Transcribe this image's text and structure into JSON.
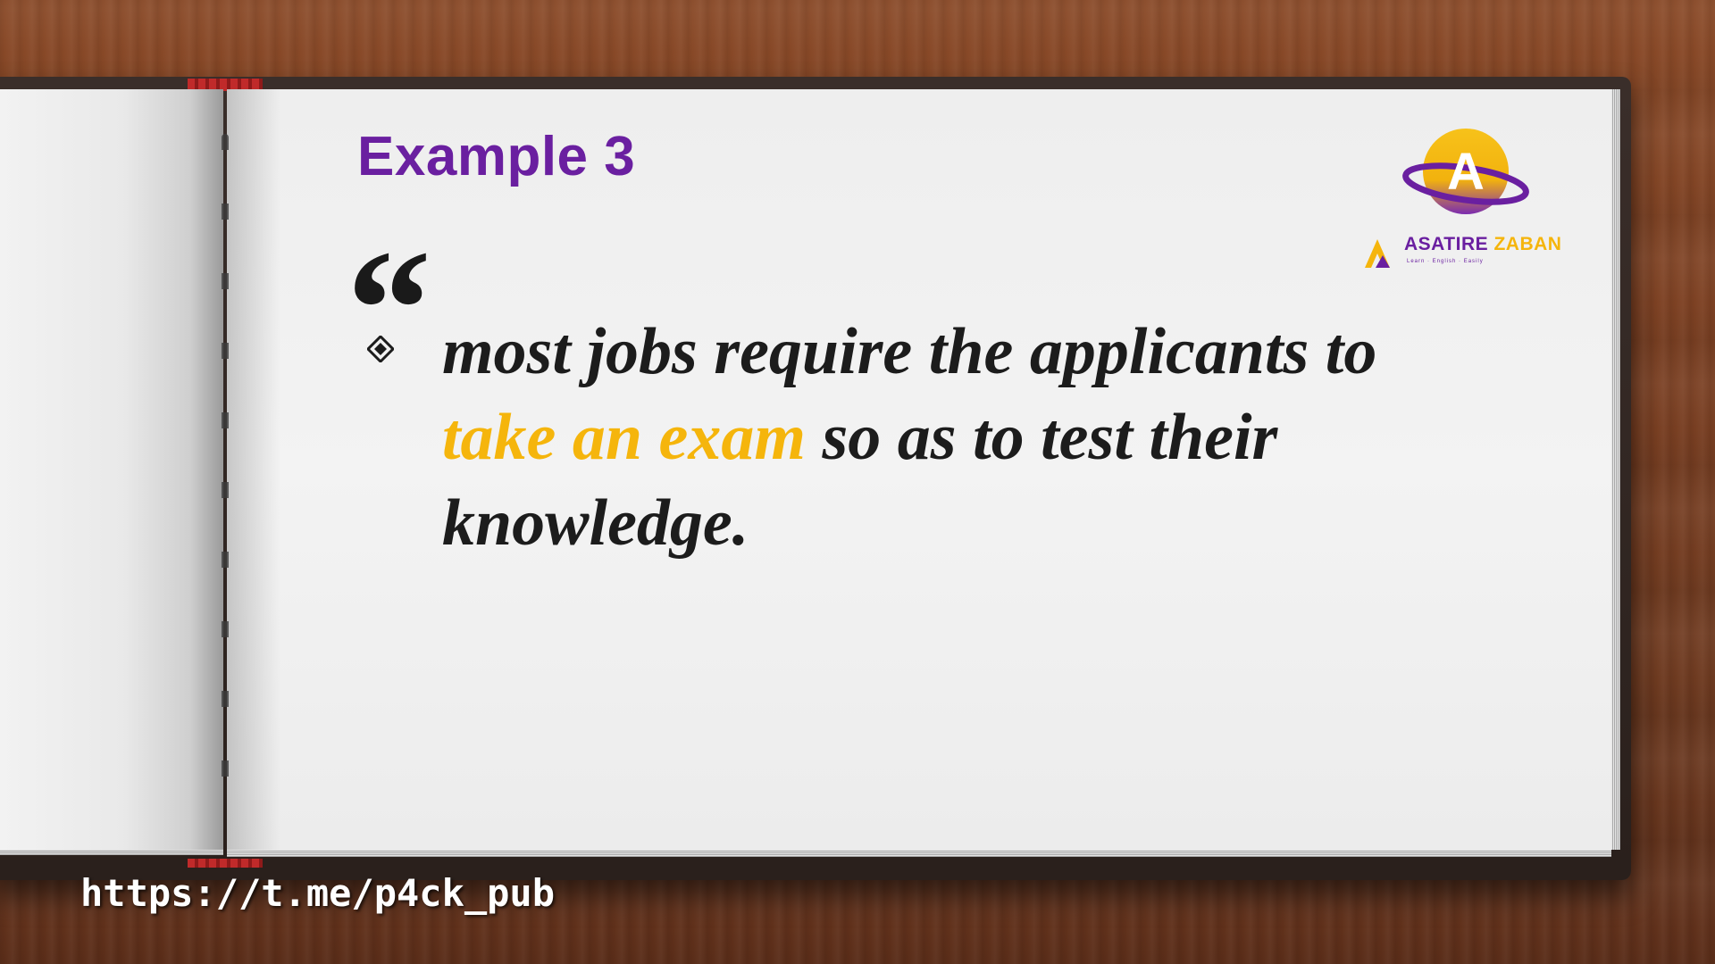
{
  "slide": {
    "title": "Example 3",
    "quote_open": "“",
    "sentence": {
      "part1": "most jobs require the applicants to ",
      "highlight": "take an exam",
      "part2": " so as to test their knowledge."
    },
    "bullet_icon": "diamond-bullet-icon"
  },
  "logo": {
    "letter": "A",
    "brand_part1": "ASATIRE",
    "brand_part2": "ZABAN",
    "tagline": "Learn · English · Easily"
  },
  "footer": {
    "url": "https://t.me/p4ck_pub"
  },
  "colors": {
    "title": "#6a1fa0",
    "highlight": "#f5b50c",
    "text": "#1c1c1c",
    "wood": "#7a3f22"
  }
}
